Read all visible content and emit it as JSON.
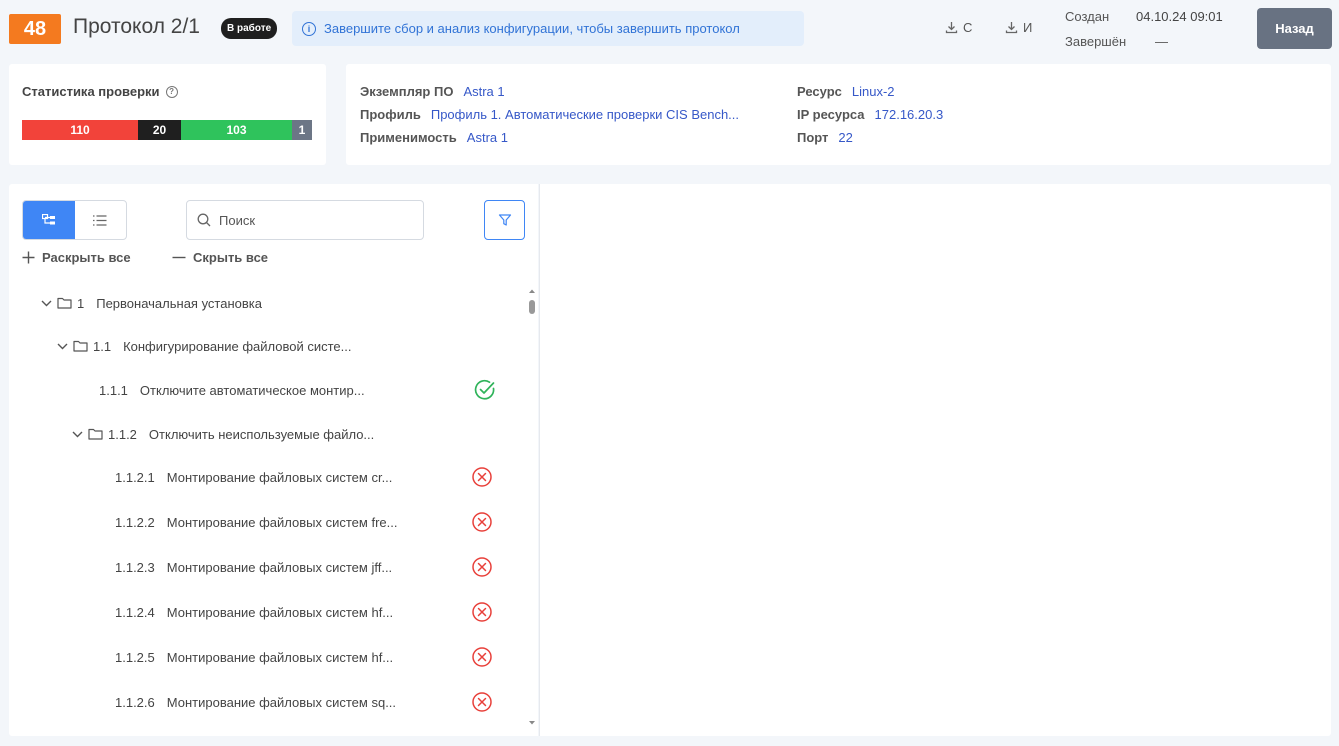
{
  "header": {
    "protocol_number": "48",
    "protocol_title": "Протокол 2/1",
    "status": "В работе",
    "banner_text": "Завершите сбор и анализ конфигурации, чтобы завершить протокол",
    "download_c_label": "С",
    "download_i_label": "И",
    "created_label": "Создан",
    "created_value": "04.10.24 09:01",
    "finished_label": "Завершён",
    "finished_value": "—",
    "back_label": "Назад"
  },
  "stats": {
    "title": "Статистика проверки",
    "segments": [
      {
        "value": "110",
        "fraction": 0.4,
        "color": "#f2433a"
      },
      {
        "value": "20",
        "fraction": 0.148,
        "color": "#1f1f1f"
      },
      {
        "value": "103",
        "fraction": 0.384,
        "color": "#2fc35c"
      },
      {
        "value": "1",
        "fraction": 0.068,
        "color": "#6c7686"
      }
    ]
  },
  "info": {
    "instance_label": "Экземпляр ПО",
    "instance_value": "Astra 1",
    "profile_label": "Профиль",
    "profile_value": "Профиль 1. Автоматические проверки CIS Bench...",
    "applicability_label": "Применимость",
    "applicability_value": "Astra 1",
    "resource_label": "Ресурс",
    "resource_value": "Linux-2",
    "ip_label": "IP ресурса",
    "ip_value": "172.16.20.3",
    "port_label": "Порт",
    "port_value": "22"
  },
  "tree": {
    "search_placeholder": "Поиск",
    "expand_all": "Раскрыть все",
    "collapse_all": "Скрыть все",
    "items": [
      {
        "num": "1",
        "label": "Первоначальная установка",
        "type": "folder",
        "status": ""
      },
      {
        "num": "1.1",
        "label": "Конфигурирование файловой систе...",
        "type": "folder",
        "status": ""
      },
      {
        "num": "1.1.1",
        "label": "Отключите автоматическое монтир...",
        "type": "leaf",
        "status": "passed"
      },
      {
        "num": "1.1.2",
        "label": "Отключить неиспользуемые файло...",
        "type": "folder",
        "status": ""
      },
      {
        "num": "1.1.2.1",
        "label": "Монтирование файловых систем cr...",
        "type": "leaf",
        "status": "failed"
      },
      {
        "num": "1.1.2.2",
        "label": "Монтирование файловых систем fre...",
        "type": "leaf",
        "status": "failed"
      },
      {
        "num": "1.1.2.3",
        "label": "Монтирование файловых систем jff...",
        "type": "leaf",
        "status": "failed"
      },
      {
        "num": "1.1.2.4",
        "label": "Монтирование файловых систем hf...",
        "type": "leaf",
        "status": "failed"
      },
      {
        "num": "1.1.2.5",
        "label": "Монтирование файловых систем hf...",
        "type": "leaf",
        "status": "failed"
      },
      {
        "num": "1.1.2.6",
        "label": "Монтирование файловых систем sq...",
        "type": "leaf",
        "status": "failed"
      }
    ]
  },
  "colors": {
    "accent": "#3f86f5",
    "orange": "#f47a1f",
    "passed": "#2fb35a",
    "failed": "#e8403a",
    "link": "#3658c8"
  }
}
